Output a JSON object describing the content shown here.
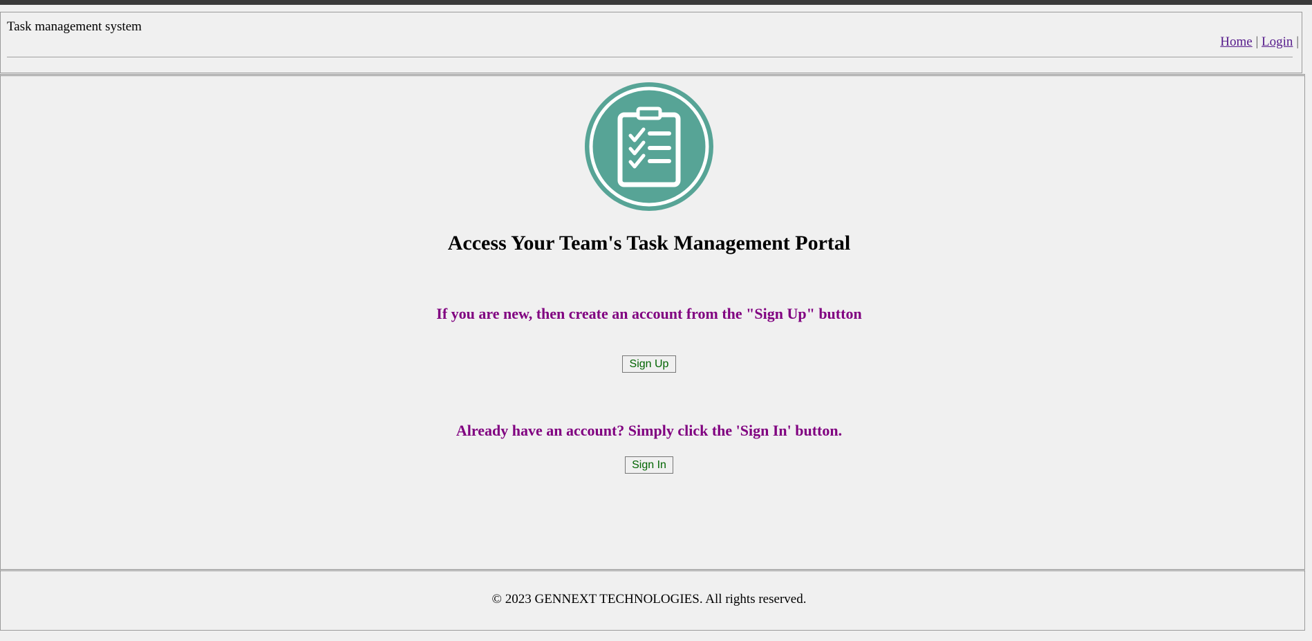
{
  "header": {
    "title": "Task management system",
    "nav": {
      "home_label": "Home",
      "login_label": "Login",
      "separator": "|"
    }
  },
  "main": {
    "logo_icon": "clipboard-checklist-icon",
    "heading": "Access Your Team's Task Management Portal",
    "signup_prompt": "If you are new, then create an account from the \"Sign Up\" button",
    "signup_button": "Sign Up",
    "signin_prompt": "Already have an account? Simply click the 'Sign In' button.",
    "signin_button": "Sign In"
  },
  "footer": {
    "copyright": "© 2023 GENNEXT TECHNOLOGIES. All rights reserved."
  },
  "colors": {
    "logo_teal": "#57a496",
    "prompt_purple": "#800080",
    "button_text_green": "#006400",
    "link_visited": "#551a8b"
  }
}
